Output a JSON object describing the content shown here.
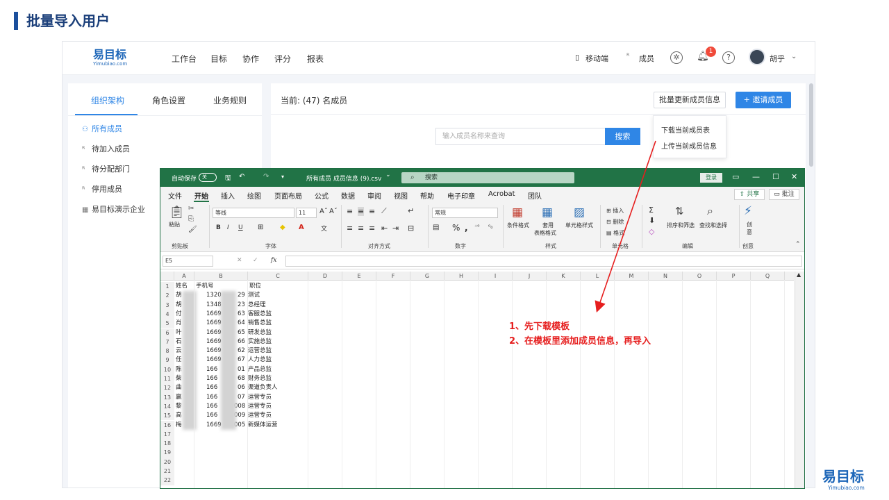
{
  "slide": {
    "title": "批量导入用户"
  },
  "app": {
    "logo": {
      "name": "易目标",
      "domain": "Yimubiao.com"
    },
    "nav": [
      "工作台",
      "目标",
      "协作",
      "评分",
      "报表"
    ],
    "mobile_label": "移动端",
    "members_label": "成员",
    "notification_count": "1",
    "help_icon": "?",
    "user_name": "胡乎",
    "left_tabs": [
      "组织架构",
      "角色设置",
      "业务规则"
    ],
    "left_items": [
      "所有成员",
      "待加入成员",
      "待分配部门",
      "停用成员",
      "易目标演示企业"
    ],
    "member_count": "当前: (47) 名成员",
    "bulk_update_label": "批量更新成员信息",
    "invite_label": "+ 邀请成员",
    "search_placeholder": "输入成员名称来查询",
    "search_button": "搜索",
    "dropdown": [
      "下载当前成员表",
      "上传当前成员信息"
    ]
  },
  "excel": {
    "autosave_label": "自动保存",
    "autosave_state": "关",
    "file_name": "所有成员 成员信息 (9).csv",
    "file_chevron": "⌄",
    "search_label": "搜索",
    "login_label": "登录",
    "window_icons": [
      "▭",
      "—",
      "☐",
      "✕"
    ],
    "menu_tabs": [
      "文件",
      "开始",
      "插入",
      "绘图",
      "页面布局",
      "公式",
      "数据",
      "审阅",
      "视图",
      "帮助",
      "电子印章",
      "Acrobat",
      "团队"
    ],
    "share_label": "共享",
    "comment_label": "批注",
    "ribbon": {
      "paste": "粘贴",
      "clipboard": "剪贴板",
      "font_name": "等线",
      "font_size": "11",
      "font_buttons": [
        "B",
        "I",
        "U"
      ],
      "font_group": "字体",
      "align_group": "对齐方式",
      "number_format": "常规",
      "number_group": "数字",
      "cond_format": "条件格式",
      "table_format_1": "套用",
      "table_format_2": "表格格式",
      "cell_style": "单元格样式",
      "styles_group": "样式",
      "insert": "插入",
      "delete": "删除",
      "format": "格式",
      "cells_group": "单元格",
      "sort_filter": "排序和筛选",
      "find_select": "查找和选择",
      "edit_group": "编辑",
      "create_1": "创",
      "create_2": "意",
      "ideas_group": "创意"
    },
    "name_box": "E5",
    "fx": "fx",
    "columns": [
      "A",
      "B",
      "C",
      "D",
      "E",
      "F",
      "G",
      "H",
      "I",
      "J",
      "K",
      "L",
      "M",
      "N",
      "O",
      "P",
      "Q"
    ],
    "row_numbers": [
      "1",
      "2",
      "3",
      "4",
      "5",
      "6",
      "7",
      "8",
      "9",
      "10",
      "11",
      "12",
      "13",
      "14",
      "15",
      "16",
      "17",
      "18",
      "19",
      "20",
      "21",
      "22"
    ],
    "header_row": [
      "姓名",
      "手机号",
      "职位"
    ],
    "rows": [
      {
        "name": "胡",
        "phone_a": "1320",
        "phone_b": "29",
        "title": "测试"
      },
      {
        "name": "胡",
        "phone_a": "1348",
        "phone_b": "23",
        "title": "总经理"
      },
      {
        "name": "付",
        "phone_a": "1669",
        "phone_b": "63",
        "title": "客服总监"
      },
      {
        "name": "肖",
        "phone_a": "1669",
        "phone_b": "64",
        "title": "销售总监"
      },
      {
        "name": "叶",
        "phone_a": "1669",
        "phone_b": "65",
        "title": "研发总监"
      },
      {
        "name": "石",
        "phone_a": "1669",
        "phone_b": "66",
        "title": "实施总监"
      },
      {
        "name": "云",
        "phone_a": "1669",
        "phone_b": "62",
        "title": "运营总监"
      },
      {
        "name": "任",
        "phone_a": "1669",
        "phone_b": "67",
        "title": "人力总监"
      },
      {
        "name": "陈",
        "phone_a": "166",
        "phone_b": "01",
        "title": "产品总监"
      },
      {
        "name": "柴",
        "phone_a": "166",
        "phone_b": "68",
        "title": "财务总监"
      },
      {
        "name": "曲",
        "phone_a": "166",
        "phone_b": "06",
        "title": "渠道负责人"
      },
      {
        "name": "嬴",
        "phone_a": "166",
        "phone_b": "07",
        "title": "运营专员"
      },
      {
        "name": "黎",
        "phone_a": "166",
        "phone_b": "008",
        "title": "运营专员"
      },
      {
        "name": "高",
        "phone_a": "166",
        "phone_b": "009",
        "title": "运营专员"
      },
      {
        "name": "梅",
        "phone_a": "1669",
        "phone_b": "005",
        "title": "新媒体运营"
      }
    ]
  },
  "annotation": {
    "step1": "1、先下载模板",
    "step2": "2、在模板里添加成员信息，再导入",
    "color": "#e61e1e"
  },
  "footer_logo": {
    "name": "易目标",
    "domain": "Yimubiao.com"
  }
}
